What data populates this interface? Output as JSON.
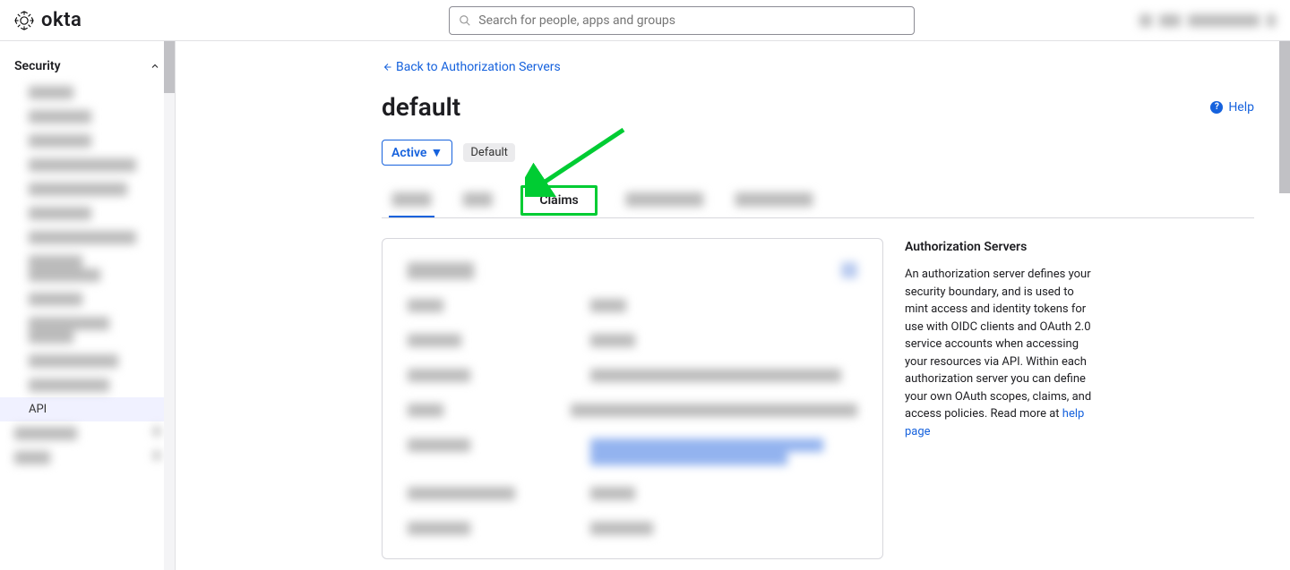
{
  "brand": "okta",
  "search": {
    "placeholder": "Search for people, apps and groups"
  },
  "user_area": [
    "▇▇",
    "▇▇▇",
    "▇▇▇▇▇▇▇",
    "▇"
  ],
  "sidebar": {
    "section": "Security",
    "items": [
      "▇▇▇▇▇",
      "▇▇▇▇▇▇▇",
      "▇▇▇▇▇▇▇",
      "▇▇▇▇▇▇▇▇▇▇▇▇",
      "▇▇▇▇▇▇▇▇▇▇▇",
      "▇▇▇▇▇▇▇",
      "▇▇▇▇▇▇▇▇▇▇▇▇",
      "▇▇▇▇▇▇\n▇▇▇▇▇▇▇▇",
      "▇▇▇▇▇▇",
      "▇▇▇▇▇▇▇▇▇\n▇▇▇▇▇",
      "▇▇▇▇▇▇▇▇▇▇",
      "▇▇▇▇▇▇▇▇▇"
    ],
    "api_label": "API",
    "below": [
      "▇▇▇▇▇▇▇",
      "▇▇▇▇"
    ]
  },
  "main": {
    "back_label": "Back to Authorization Servers",
    "title": "default",
    "help_label": "Help",
    "status_button": "Active",
    "default_pill": "Default",
    "tabs": [
      "▇▇▇▇",
      "▇▇▇",
      "Claims",
      "▇▇▇▇▇▇▇▇",
      "▇▇▇▇▇▇▇▇"
    ],
    "card_title": "▇▇▇▇▇▇",
    "card_rows": [
      {
        "k": "▇▇▇▇",
        "v": "▇▇▇▇",
        "link": false
      },
      {
        "k": "▇▇▇▇▇▇",
        "v": "▇▇▇▇▇",
        "link": false
      },
      {
        "k": "▇▇▇▇▇▇▇",
        "v": "▇▇▇▇▇▇▇▇▇▇▇▇▇▇▇▇▇▇▇▇▇▇▇▇▇▇▇▇",
        "link": false
      },
      {
        "k": "▇▇▇▇",
        "v": "▇▇▇▇▇▇▇▇▇▇▇▇▇▇▇▇▇▇▇▇▇▇▇▇▇▇▇▇▇▇▇▇",
        "link": false
      },
      {
        "k": "▇▇▇▇▇▇▇",
        "v": "▇▇▇▇▇▇▇▇▇▇▇▇▇▇▇▇▇▇▇▇▇▇▇▇▇▇\n▇▇▇▇▇▇▇▇▇▇▇▇▇▇▇▇▇▇▇▇▇▇",
        "link": true
      },
      {
        "k": "▇▇▇▇▇▇▇▇▇▇▇▇",
        "v": "▇▇▇▇▇",
        "link": false
      },
      {
        "k": "▇▇▇▇▇▇▇",
        "v": "▇▇▇▇▇▇▇",
        "link": false
      }
    ],
    "aside": {
      "heading": "Authorization Servers",
      "body": "An authorization server defines your security boundary, and is used to mint access and identity tokens for use with OIDC clients and OAuth 2.0 service accounts when accessing your resources via API. Within each authorization server you can define your own OAuth scopes, claims, and access policies. Read more at ",
      "link_text": "help page"
    }
  }
}
